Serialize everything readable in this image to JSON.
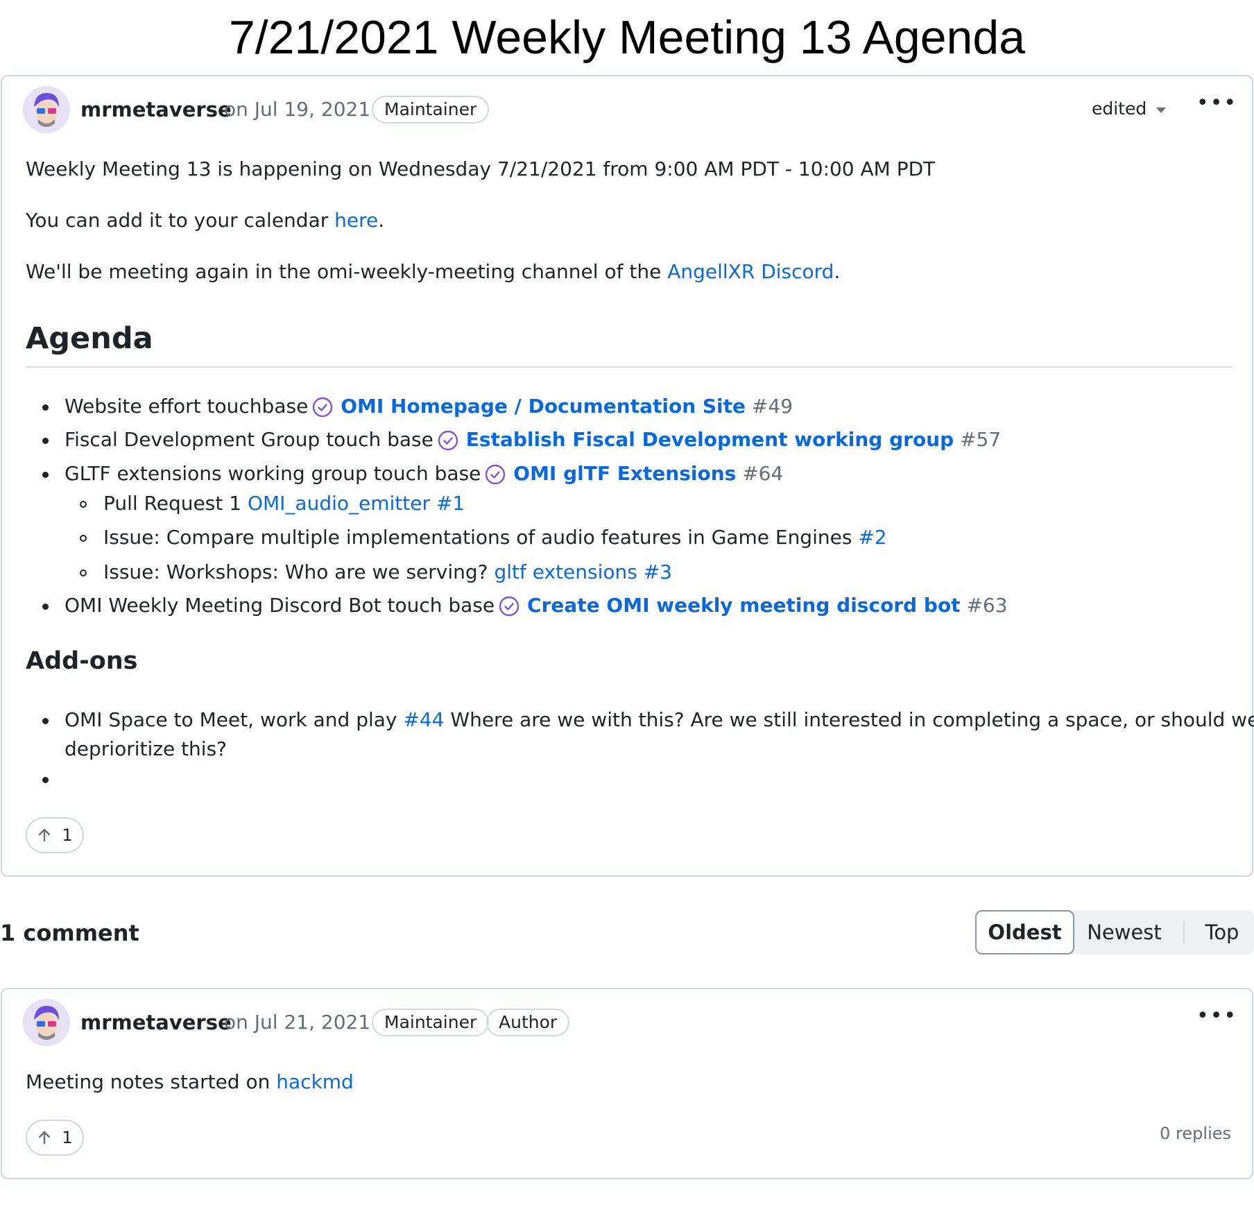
{
  "page_title": "7/21/2021 Weekly Meeting 13 Agenda",
  "post": {
    "author": "mrmetaverse",
    "date": "on Jul 19, 2021",
    "badge": "Maintainer",
    "edited_label": "edited",
    "menu_glyph": "•••",
    "line1": "Weekly Meeting 13 is happening on Wednesday 7/21/2021 from 9:00 AM PDT - 10:00 AM PDT",
    "line2_prefix": "You can add it to your calendar ",
    "line2_link": "here",
    "line2_suffix": ".",
    "line3_prefix": "We'll be meeting again in the omi-weekly-meeting channel of the ",
    "line3_link": "AngellXR Discord",
    "line3_suffix": ".",
    "agenda_heading": "Agenda",
    "agenda": [
      {
        "text": "Website effort touchbase",
        "link": "OMI Homepage / Documentation Site",
        "num": "#49"
      },
      {
        "text": "Fiscal Development Group touch base",
        "link": "Establish Fiscal Development working group",
        "num": "#57"
      },
      {
        "text": "GLTF extensions working group touch base",
        "link": "OMI glTF Extensions",
        "num": "#64"
      },
      {
        "text": "OMI Weekly Meeting Discord Bot touch base",
        "link": "Create OMI weekly meeting discord bot",
        "num": "#63"
      }
    ],
    "sub_items": [
      {
        "text": "Pull Request 1 ",
        "link": "OMI_audio_emitter #1"
      },
      {
        "text": "Issue: Compare multiple implementations of audio features in Game Engines ",
        "link": "#2"
      },
      {
        "text": "Issue: Workshops: Who are we serving? ",
        "link": "gltf extensions #3"
      }
    ],
    "addons_heading": "Add-ons",
    "addon_prefix": "OMI Space to Meet, work and play ",
    "addon_link": "#44",
    "addon_suffix": " Where are we with this? Are we still interested in completing a space, or should we",
    "addon_line2": "deprioritize this?",
    "upvotes": "1"
  },
  "comments_header": "1 comment",
  "sort_tabs": [
    "Oldest",
    "Newest",
    "Top"
  ],
  "comment": {
    "author": "mrmetaverse",
    "date": "on Jul 21, 2021",
    "badges": [
      "Maintainer",
      "Author"
    ],
    "menu_glyph": "•••",
    "text_prefix": "Meeting notes started on ",
    "text_link": "hackmd",
    "upvotes": "1",
    "replies": "0 replies"
  },
  "colors": {
    "link": "#0969da",
    "closed_issue": "#8250df",
    "border": "#d0d7de",
    "muted": "#656d76"
  },
  "icons": {
    "issue_status": "check-circle-icon",
    "upvote": "arrow-up-icon",
    "more": "kebab-icon",
    "dropdown": "caret-down-icon"
  }
}
